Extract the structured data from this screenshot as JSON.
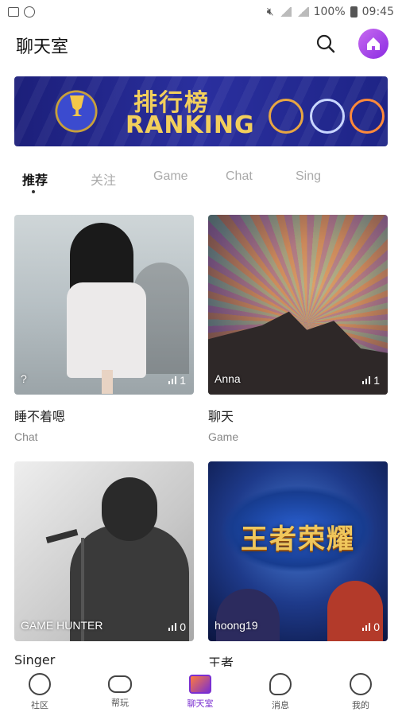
{
  "status_bar": {
    "battery": "100%",
    "time": "09:45"
  },
  "header": {
    "title": "聊天室"
  },
  "banner": {
    "title_cn": "排行榜",
    "title_en": "RANKING"
  },
  "tabs": [
    {
      "label": "推荐",
      "active": true
    },
    {
      "label": "关注",
      "active": false
    },
    {
      "label": "Game",
      "active": false
    },
    {
      "label": "Chat",
      "active": false
    },
    {
      "label": "Sing",
      "active": false
    }
  ],
  "rooms": [
    {
      "name": "?",
      "count": "1",
      "title": "睡不着嗯",
      "category": "Chat"
    },
    {
      "name": "Anna",
      "count": "1",
      "title": "聊天",
      "category": "Game"
    },
    {
      "name": "GAME HUNTER",
      "count": "0",
      "title": "Singer",
      "category": ""
    },
    {
      "name": "hoong19",
      "count": "0",
      "title": "王者",
      "category": ""
    }
  ],
  "game_logo": "王者荣耀",
  "bottom_nav": [
    {
      "label": "社区",
      "icon": "compass-icon"
    },
    {
      "label": "帮玩",
      "icon": "gamepad-icon"
    },
    {
      "label": "聊天室",
      "icon": "chatroom-tv-icon",
      "active": true
    },
    {
      "label": "消息",
      "icon": "message-icon"
    },
    {
      "label": "我的",
      "icon": "profile-icon"
    }
  ],
  "colors": {
    "accent": "#7b2fd0",
    "banner": "#22278f",
    "gold": "#f2cf5c"
  }
}
